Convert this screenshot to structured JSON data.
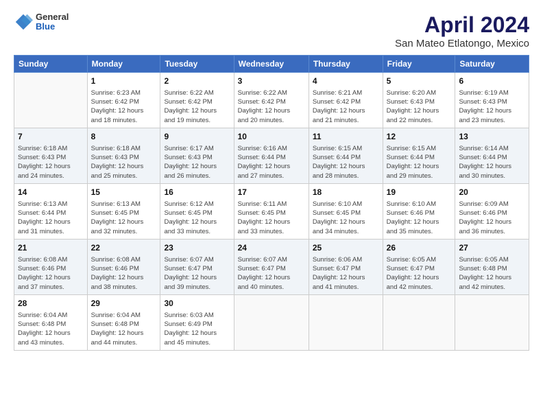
{
  "logo": {
    "line1": "General",
    "line2": "Blue"
  },
  "title": "April 2024",
  "subtitle": "San Mateo Etlatongo, Mexico",
  "weekdays": [
    "Sunday",
    "Monday",
    "Tuesday",
    "Wednesday",
    "Thursday",
    "Friday",
    "Saturday"
  ],
  "weeks": [
    [
      {
        "day": "",
        "info": ""
      },
      {
        "day": "1",
        "info": "Sunrise: 6:23 AM\nSunset: 6:42 PM\nDaylight: 12 hours\nand 18 minutes."
      },
      {
        "day": "2",
        "info": "Sunrise: 6:22 AM\nSunset: 6:42 PM\nDaylight: 12 hours\nand 19 minutes."
      },
      {
        "day": "3",
        "info": "Sunrise: 6:22 AM\nSunset: 6:42 PM\nDaylight: 12 hours\nand 20 minutes."
      },
      {
        "day": "4",
        "info": "Sunrise: 6:21 AM\nSunset: 6:42 PM\nDaylight: 12 hours\nand 21 minutes."
      },
      {
        "day": "5",
        "info": "Sunrise: 6:20 AM\nSunset: 6:43 PM\nDaylight: 12 hours\nand 22 minutes."
      },
      {
        "day": "6",
        "info": "Sunrise: 6:19 AM\nSunset: 6:43 PM\nDaylight: 12 hours\nand 23 minutes."
      }
    ],
    [
      {
        "day": "7",
        "info": "Sunrise: 6:18 AM\nSunset: 6:43 PM\nDaylight: 12 hours\nand 24 minutes."
      },
      {
        "day": "8",
        "info": "Sunrise: 6:18 AM\nSunset: 6:43 PM\nDaylight: 12 hours\nand 25 minutes."
      },
      {
        "day": "9",
        "info": "Sunrise: 6:17 AM\nSunset: 6:43 PM\nDaylight: 12 hours\nand 26 minutes."
      },
      {
        "day": "10",
        "info": "Sunrise: 6:16 AM\nSunset: 6:44 PM\nDaylight: 12 hours\nand 27 minutes."
      },
      {
        "day": "11",
        "info": "Sunrise: 6:15 AM\nSunset: 6:44 PM\nDaylight: 12 hours\nand 28 minutes."
      },
      {
        "day": "12",
        "info": "Sunrise: 6:15 AM\nSunset: 6:44 PM\nDaylight: 12 hours\nand 29 minutes."
      },
      {
        "day": "13",
        "info": "Sunrise: 6:14 AM\nSunset: 6:44 PM\nDaylight: 12 hours\nand 30 minutes."
      }
    ],
    [
      {
        "day": "14",
        "info": "Sunrise: 6:13 AM\nSunset: 6:44 PM\nDaylight: 12 hours\nand 31 minutes."
      },
      {
        "day": "15",
        "info": "Sunrise: 6:13 AM\nSunset: 6:45 PM\nDaylight: 12 hours\nand 32 minutes."
      },
      {
        "day": "16",
        "info": "Sunrise: 6:12 AM\nSunset: 6:45 PM\nDaylight: 12 hours\nand 33 minutes."
      },
      {
        "day": "17",
        "info": "Sunrise: 6:11 AM\nSunset: 6:45 PM\nDaylight: 12 hours\nand 33 minutes."
      },
      {
        "day": "18",
        "info": "Sunrise: 6:10 AM\nSunset: 6:45 PM\nDaylight: 12 hours\nand 34 minutes."
      },
      {
        "day": "19",
        "info": "Sunrise: 6:10 AM\nSunset: 6:46 PM\nDaylight: 12 hours\nand 35 minutes."
      },
      {
        "day": "20",
        "info": "Sunrise: 6:09 AM\nSunset: 6:46 PM\nDaylight: 12 hours\nand 36 minutes."
      }
    ],
    [
      {
        "day": "21",
        "info": "Sunrise: 6:08 AM\nSunset: 6:46 PM\nDaylight: 12 hours\nand 37 minutes."
      },
      {
        "day": "22",
        "info": "Sunrise: 6:08 AM\nSunset: 6:46 PM\nDaylight: 12 hours\nand 38 minutes."
      },
      {
        "day": "23",
        "info": "Sunrise: 6:07 AM\nSunset: 6:47 PM\nDaylight: 12 hours\nand 39 minutes."
      },
      {
        "day": "24",
        "info": "Sunrise: 6:07 AM\nSunset: 6:47 PM\nDaylight: 12 hours\nand 40 minutes."
      },
      {
        "day": "25",
        "info": "Sunrise: 6:06 AM\nSunset: 6:47 PM\nDaylight: 12 hours\nand 41 minutes."
      },
      {
        "day": "26",
        "info": "Sunrise: 6:05 AM\nSunset: 6:47 PM\nDaylight: 12 hours\nand 42 minutes."
      },
      {
        "day": "27",
        "info": "Sunrise: 6:05 AM\nSunset: 6:48 PM\nDaylight: 12 hours\nand 42 minutes."
      }
    ],
    [
      {
        "day": "28",
        "info": "Sunrise: 6:04 AM\nSunset: 6:48 PM\nDaylight: 12 hours\nand 43 minutes."
      },
      {
        "day": "29",
        "info": "Sunrise: 6:04 AM\nSunset: 6:48 PM\nDaylight: 12 hours\nand 44 minutes."
      },
      {
        "day": "30",
        "info": "Sunrise: 6:03 AM\nSunset: 6:49 PM\nDaylight: 12 hours\nand 45 minutes."
      },
      {
        "day": "",
        "info": ""
      },
      {
        "day": "",
        "info": ""
      },
      {
        "day": "",
        "info": ""
      },
      {
        "day": "",
        "info": ""
      }
    ]
  ]
}
